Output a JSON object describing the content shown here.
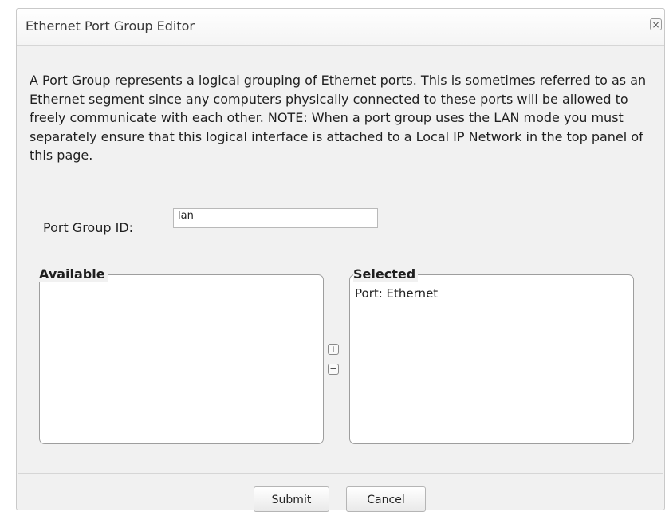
{
  "dialog": {
    "title": "Ethernet Port Group Editor",
    "close_label": "×"
  },
  "description": "A Port Group represents a logical grouping of Ethernet ports. This is sometimes referred to as an Ethernet segment since any computers physically connected to these ports will be allowed to freely communicate with each other. NOTE: When a port group uses the LAN mode you must separately ensure that this logical interface is attached to a Local IP Network in the top panel of this page.",
  "port_group_id": {
    "label": "Port Group ID:",
    "value": "lan"
  },
  "available": {
    "legend": "Available",
    "items": []
  },
  "selected": {
    "legend": "Selected",
    "items": [
      "Port: Ethernet"
    ]
  },
  "move_buttons": {
    "add_label": "+",
    "remove_label": "−"
  },
  "footer": {
    "submit_label": "Submit",
    "cancel_label": "Cancel"
  }
}
